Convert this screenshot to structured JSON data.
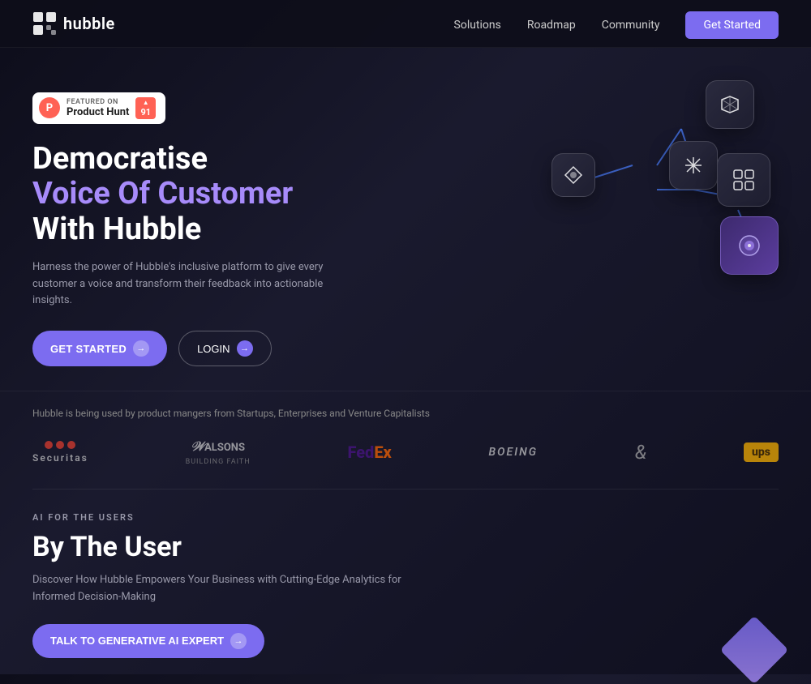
{
  "navbar": {
    "logo_text": "hubble",
    "nav_items": [
      {
        "label": "Solutions",
        "href": "#"
      },
      {
        "label": "Roadmap",
        "href": "#"
      },
      {
        "label": "Community",
        "href": "#"
      }
    ],
    "cta_label": "Get Started"
  },
  "hero": {
    "badge": {
      "featured_label": "FEATURED ON",
      "name": "Product Hunt",
      "score": "91"
    },
    "headline_line1": "Democratise",
    "headline_line2": "Voice Of Customer",
    "headline_line3": "With Hubble",
    "subtitle": "Harness the power of Hubble's inclusive platform to give every customer a voice and transform their feedback into actionable insights.",
    "btn_get_started": "GET STARTED",
    "btn_login": "LOGIN"
  },
  "logos_section": {
    "tagline": "Hubble is being used by product mangers from Startups, Enterprises and Venture Capitalists",
    "logos": [
      {
        "name": "Securitas",
        "type": "securitas"
      },
      {
        "name": "Walsons Building Faith",
        "type": "walsons"
      },
      {
        "name": "FedEx",
        "type": "fedex"
      },
      {
        "name": "Boeing",
        "type": "boeing"
      },
      {
        "name": "&",
        "type": "ampersand"
      },
      {
        "name": "UPS",
        "type": "ups"
      }
    ]
  },
  "ai_section": {
    "label": "AI FOR THE USERS",
    "headline": "By The User",
    "subtitle": "Discover How Hubble Empowers Your Business with Cutting-Edge Analytics for Informed Decision-Making",
    "btn_label": "TALK TO GENERATIVE AI EXPERT"
  }
}
